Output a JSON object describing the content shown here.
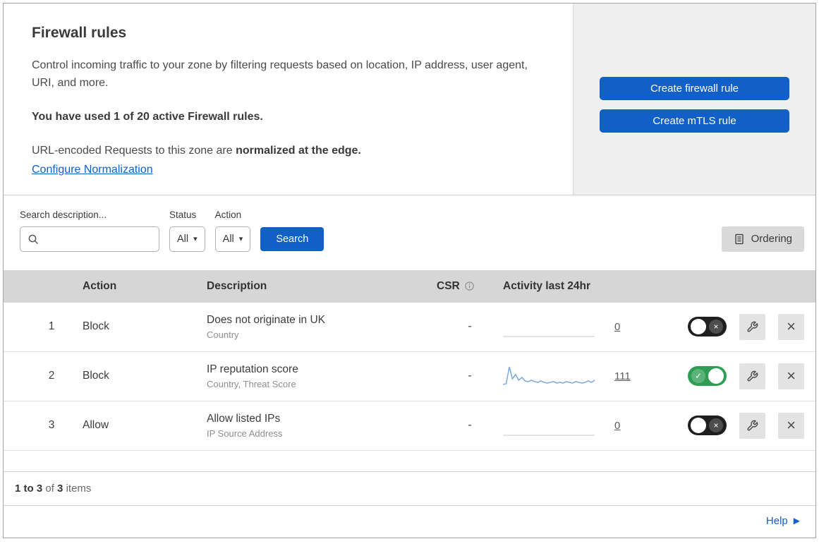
{
  "colors": {
    "primary_blue": "#1160c8",
    "toggle_green": "#2f9e55",
    "sparkline_blue": "#7fadde"
  },
  "icons": {
    "check": "✓",
    "cross": "×",
    "caret": "▾",
    "help_arrow": "▶"
  },
  "header": {
    "title": "Firewall rules",
    "description": "Control incoming traffic to your zone by filtering requests based on location, IP address, user agent, URI, and more.",
    "usage": "You have used 1 of 20 active Firewall rules.",
    "normalization_prefix": "URL-encoded Requests to this zone are",
    "normalization_bold": "normalized at the edge.",
    "normalization_link": "Configure Normalization",
    "create_firewall_button": "Create firewall rule",
    "create_mtls_button": "Create mTLS rule"
  },
  "filters": {
    "search_label": "Search description...",
    "status_label": "Status",
    "status_value": "All",
    "action_label": "Action",
    "action_value": "All",
    "search_button": "Search",
    "ordering_button": "Ordering"
  },
  "table": {
    "headers": {
      "action": "Action",
      "description": "Description",
      "csr": "CSR",
      "activity": "Activity last 24hr"
    },
    "rows": [
      {
        "number": "1",
        "action": "Block",
        "description": "Does not originate in UK",
        "criteria": "Country",
        "csr": "-",
        "activity_count": "0",
        "enabled": false,
        "sparkline": []
      },
      {
        "number": "2",
        "action": "Block",
        "description": "IP reputation score",
        "criteria": "Country, Threat Score",
        "csr": "-",
        "activity_count": "111",
        "enabled": true,
        "sparkline": [
          2,
          3,
          27,
          10,
          16,
          8,
          12,
          7,
          6,
          8,
          6,
          5,
          7,
          5,
          4,
          5,
          6,
          4,
          5,
          4,
          6,
          5,
          4,
          6,
          5,
          4,
          5,
          7,
          5,
          8
        ]
      },
      {
        "number": "3",
        "action": "Allow",
        "description": "Allow listed IPs",
        "criteria": "IP Source Address",
        "csr": "-",
        "activity_count": "0",
        "enabled": false,
        "sparkline": []
      }
    ]
  },
  "footer": {
    "range": "1 to 3",
    "of": "of",
    "total": "3",
    "items": "items",
    "help": "Help"
  }
}
